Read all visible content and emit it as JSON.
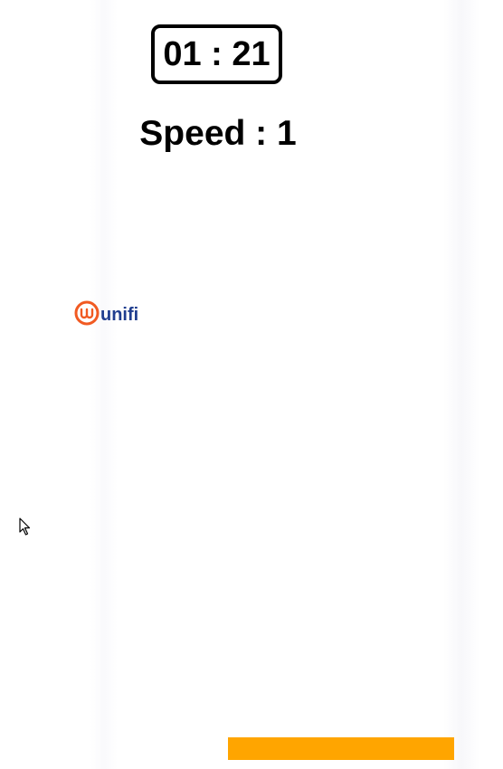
{
  "timer": {
    "text": "01 : 21"
  },
  "speed": {
    "text": "Speed : 1"
  },
  "logo": {
    "text": "unifi",
    "colors": {
      "mark": "#f15a22",
      "text": "#1f3d8f"
    }
  },
  "paddle": {
    "color": "#ffa500"
  },
  "cursor": {
    "icon": "arrow-cursor-icon"
  }
}
